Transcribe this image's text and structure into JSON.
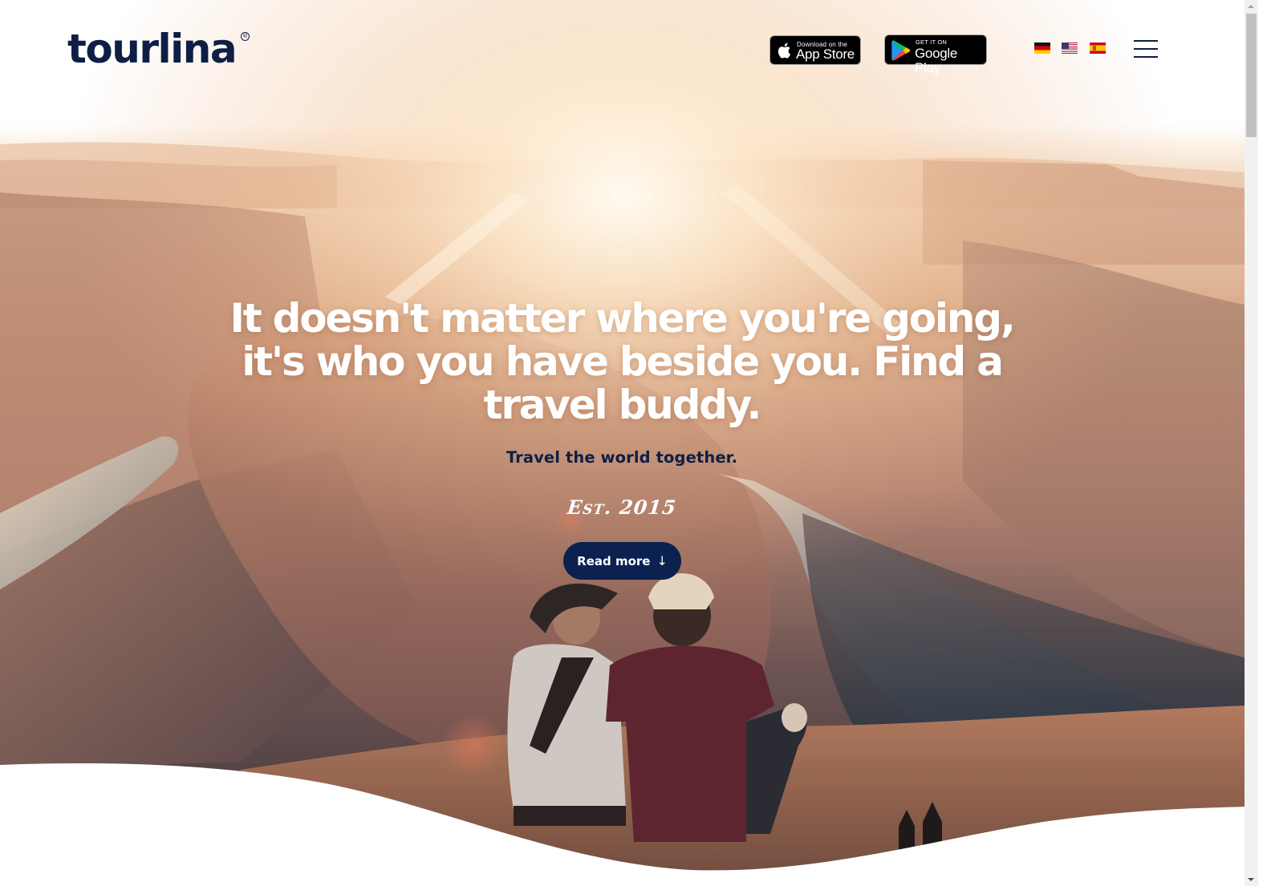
{
  "brand": {
    "logo_text": "tourlina",
    "registered_mark": "®",
    "primary_color": "#0d1f45",
    "button_color": "#0b2150"
  },
  "header": {
    "app_store": {
      "small_text": "Download on the",
      "big_text": "App Store",
      "icon": "apple-icon"
    },
    "google_play": {
      "small_text": "GET IT ON",
      "big_text": "Google Play",
      "icon": "google-play-icon"
    },
    "languages": [
      {
        "code": "de",
        "label": "German",
        "icon": "flag-germany-icon"
      },
      {
        "code": "en-us",
        "label": "English (US)",
        "icon": "flag-usa-icon"
      },
      {
        "code": "es",
        "label": "Spanish",
        "icon": "flag-spain-icon"
      }
    ],
    "menu_icon": "hamburger-menu-icon"
  },
  "hero": {
    "title": "It doesn't matter where you're going, it's who you have beside you. Find a travel buddy.",
    "subtitle": "Travel the world together.",
    "established": "Est. 2015",
    "cta": {
      "label": "Read more",
      "icon": "arrow-down-icon",
      "arrow_glyph": "↓"
    }
  }
}
